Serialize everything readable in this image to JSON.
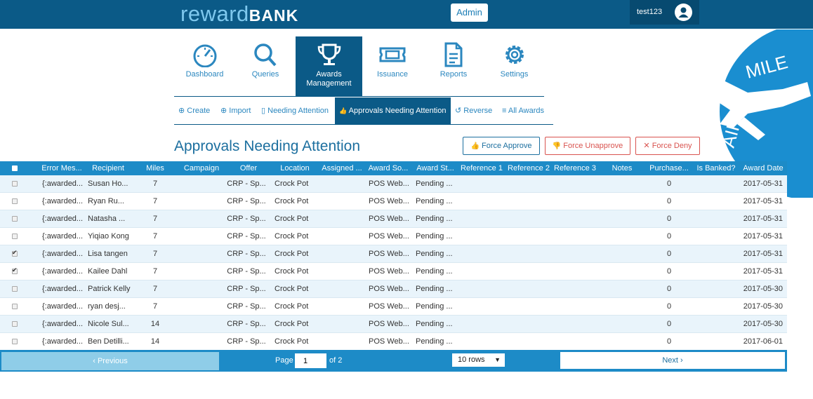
{
  "header": {
    "logo_reward": "reward",
    "logo_bank": "BANK",
    "admin_label": "Admin",
    "username": "test123"
  },
  "nav": [
    {
      "label": "Dashboard",
      "icon": "dashboard-icon"
    },
    {
      "label": "Queries",
      "icon": "search-icon"
    },
    {
      "label": "Awards Management",
      "icon": "trophy-icon"
    },
    {
      "label": "Issuance",
      "icon": "ticket-icon"
    },
    {
      "label": "Reports",
      "icon": "document-icon"
    },
    {
      "label": "Settings",
      "icon": "gear-icon"
    }
  ],
  "subnav": [
    {
      "icon": "⊕",
      "label": "Create"
    },
    {
      "icon": "⊕",
      "label": "Import"
    },
    {
      "icon": "▯",
      "label": "Needing Attention"
    },
    {
      "icon": "👍",
      "label": "Approvals Needing Attention"
    },
    {
      "icon": "↺",
      "label": "Reverse"
    },
    {
      "icon": "≡",
      "label": "All Awards"
    }
  ],
  "page": {
    "title": "Approvals Needing Attention",
    "force_approve": "Force Approve",
    "force_unapprove": "Force Unapprove",
    "force_deny": "Force Deny"
  },
  "table": {
    "columns": [
      "Error Mes...",
      "Recipient",
      "Miles",
      "Campaign",
      "Offer",
      "Location",
      "Assigned ...",
      "Award So...",
      "Award St...",
      "Reference 1",
      "Reference 2",
      "Reference 3",
      "Notes",
      "Purchase...",
      "Is Banked?",
      "Award Date"
    ],
    "rows": [
      {
        "checked": false,
        "error": "{:awarded...",
        "recipient": "Susan Ho...",
        "miles": "7",
        "offer": "CRP - Sp...",
        "location": "Crock Pot",
        "source": "POS Web...",
        "status": "Pending ...",
        "purchase": "0",
        "date": "2017-05-31"
      },
      {
        "checked": false,
        "error": "{:awarded...",
        "recipient": "Ryan Ru...",
        "miles": "7",
        "offer": "CRP - Sp...",
        "location": "Crock Pot",
        "source": "POS Web...",
        "status": "Pending ...",
        "purchase": "0",
        "date": "2017-05-31"
      },
      {
        "checked": false,
        "error": "{:awarded...",
        "recipient": "Natasha ...",
        "miles": "7",
        "offer": "CRP - Sp...",
        "location": "Crock Pot",
        "source": "POS Web...",
        "status": "Pending ...",
        "purchase": "0",
        "date": "2017-05-31"
      },
      {
        "checked": false,
        "error": "{:awarded...",
        "recipient": "Yiqiao Kong",
        "miles": "7",
        "offer": "CRP - Sp...",
        "location": "Crock Pot",
        "source": "POS Web...",
        "status": "Pending ...",
        "purchase": "0",
        "date": "2017-05-31"
      },
      {
        "checked": true,
        "error": "{:awarded...",
        "recipient": "Lisa tangen",
        "miles": "7",
        "offer": "CRP - Sp...",
        "location": "Crock Pot",
        "source": "POS Web...",
        "status": "Pending ...",
        "purchase": "0",
        "date": "2017-05-31"
      },
      {
        "checked": true,
        "error": "{:awarded...",
        "recipient": "Kailee Dahl",
        "miles": "7",
        "offer": "CRP - Sp...",
        "location": "Crock Pot",
        "source": "POS Web...",
        "status": "Pending ...",
        "purchase": "0",
        "date": "2017-05-31"
      },
      {
        "checked": false,
        "error": "{:awarded...",
        "recipient": "Patrick Kelly",
        "miles": "7",
        "offer": "CRP - Sp...",
        "location": "Crock Pot",
        "source": "POS Web...",
        "status": "Pending ...",
        "purchase": "0",
        "date": "2017-05-30"
      },
      {
        "checked": false,
        "error": "{:awarded...",
        "recipient": "ryan desj...",
        "miles": "7",
        "offer": "CRP - Sp...",
        "location": "Crock Pot",
        "source": "POS Web...",
        "status": "Pending ...",
        "purchase": "0",
        "date": "2017-05-30"
      },
      {
        "checked": false,
        "error": "{:awarded...",
        "recipient": "Nicole Sul...",
        "miles": "14",
        "offer": "CRP - Sp...",
        "location": "Crock Pot",
        "source": "POS Web...",
        "status": "Pending ...",
        "purchase": "0",
        "date": "2017-05-30"
      },
      {
        "checked": false,
        "error": "{:awarded...",
        "recipient": "Ben Detilli...",
        "miles": "14",
        "offer": "CRP - Sp...",
        "location": "Crock Pot",
        "source": "POS Web...",
        "status": "Pending ...",
        "purchase": "0",
        "date": "2017-06-01"
      }
    ]
  },
  "pager": {
    "previous": "‹ Previous",
    "page_label": "Page",
    "page_value": "1",
    "of_label": "of 2",
    "rows_option": "10 rows",
    "next": "Next ›"
  },
  "brand_badge": {
    "text": "AIR MILES"
  },
  "colors": {
    "primary": "#0b5a87",
    "accent": "#1d8bc7",
    "danger": "#d9534f"
  }
}
